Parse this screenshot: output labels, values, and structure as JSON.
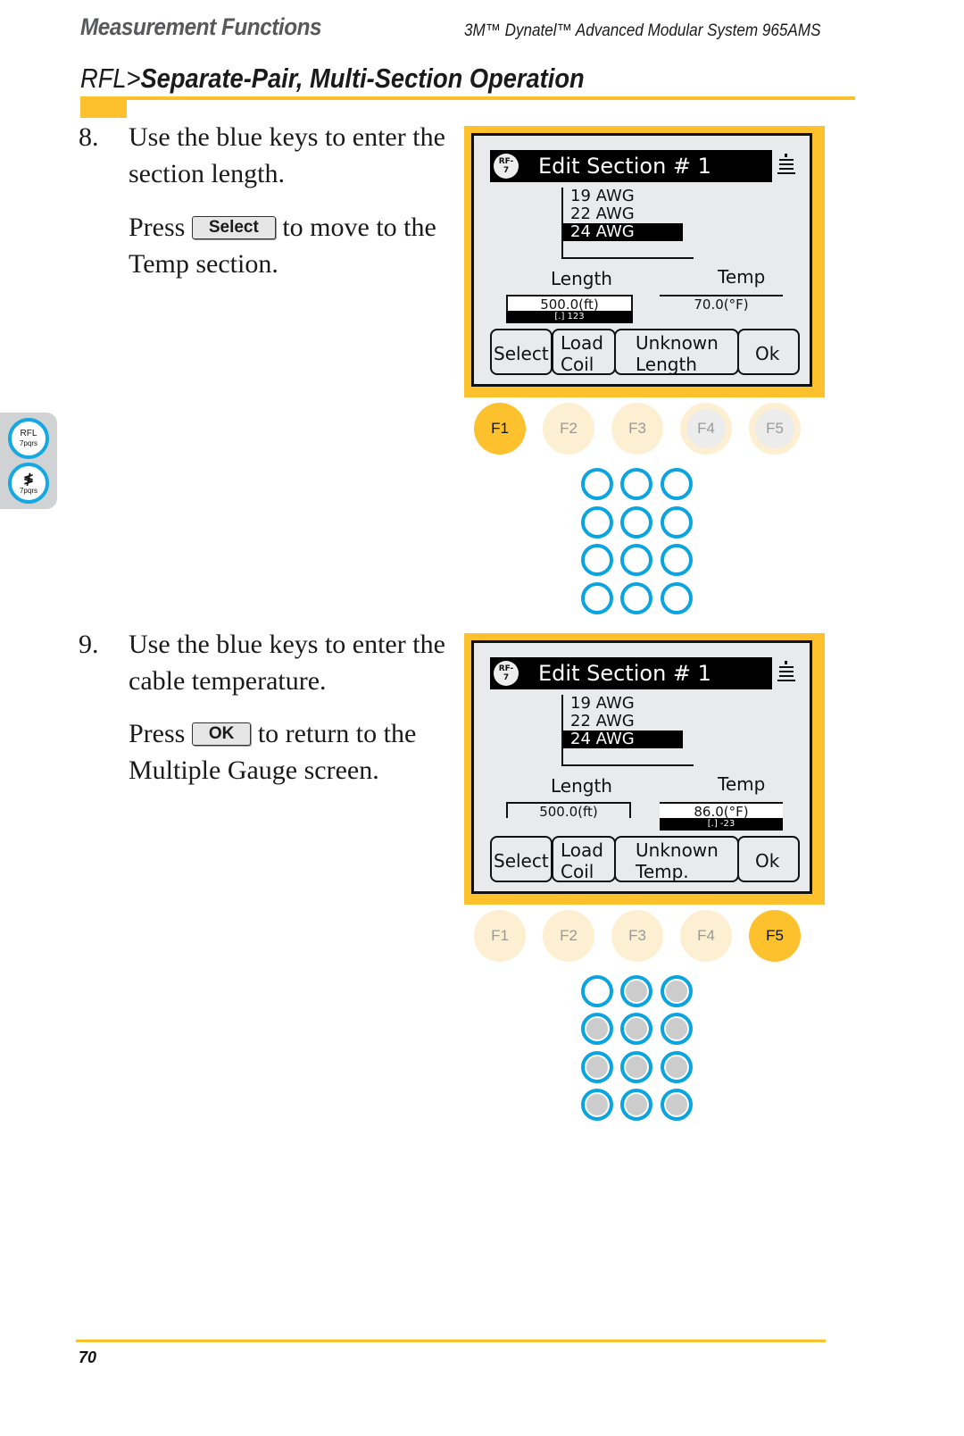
{
  "header": {
    "section": "Measurement Functions",
    "product": "3M™ Dynatel™ Advanced Modular System 965AMS"
  },
  "heading": {
    "prefix": "RFL>",
    "title": "Separate-Pair, Multi-Section Operation"
  },
  "side_tab": {
    "buttons": [
      {
        "top": "RFL",
        "bottom": "7pqrs",
        "icon": "rfl-key"
      },
      {
        "top": "⚡",
        "bottom": "7pqrs",
        "icon": "fault-key"
      }
    ]
  },
  "steps": [
    {
      "number": "8.",
      "text": "Use the blue keys to enter the section length.",
      "press_before": "Press",
      "key": "Select",
      "press_after": "to move to the Temp section."
    },
    {
      "number": "9.",
      "text": "Use the blue keys to enter the cable temperature.",
      "press_before": "Press",
      "key": "OK",
      "press_after": "to return to the Multiple Gauge screen."
    }
  ],
  "screens": [
    {
      "icon_text": "RF-\n7",
      "title": "Edit Section #  1",
      "gauges": [
        "19 AWG",
        "22 AWG",
        "24 AWG"
      ],
      "selected_gauge": "24 AWG",
      "length_label": "Length",
      "temp_label": "Temp",
      "length_value": "500.0(ft)",
      "temp_value": "70.0(°F)",
      "active_field": "length",
      "hint": "[.]  123",
      "softkeys": [
        "Select",
        "Load\nCoil",
        "Unknown\nLength",
        "Ok"
      ],
      "fkeys": [
        "F1",
        "F2",
        "F3",
        "F4",
        "F5"
      ],
      "active_fkey": "F1"
    },
    {
      "icon_text": "RF-\n7",
      "title": "Edit Section #  1",
      "gauges": [
        "19 AWG",
        "22 AWG",
        "24 AWG"
      ],
      "selected_gauge": "24 AWG",
      "length_label": "Length",
      "temp_label": "Temp",
      "length_value": "500.0(ft)",
      "temp_value": "86.0(°F)",
      "active_field": "temp",
      "hint": "[.]  -23",
      "softkeys": [
        "Select",
        "Load\nCoil",
        "Unknown\nTemp.",
        "Ok"
      ],
      "fkeys": [
        "F1",
        "F2",
        "F3",
        "F4",
        "F5"
      ],
      "active_fkey": "F5"
    }
  ],
  "keypads": [
    {
      "state": "all-active"
    },
    {
      "state": "first-key-active-rest-dimmed"
    }
  ],
  "colors": {
    "accent_yellow": "#fdc12e",
    "key_blue": "#0aa5e0",
    "fkey_inactive": "#fdf0d2"
  },
  "footer": {
    "page_number": "70"
  }
}
